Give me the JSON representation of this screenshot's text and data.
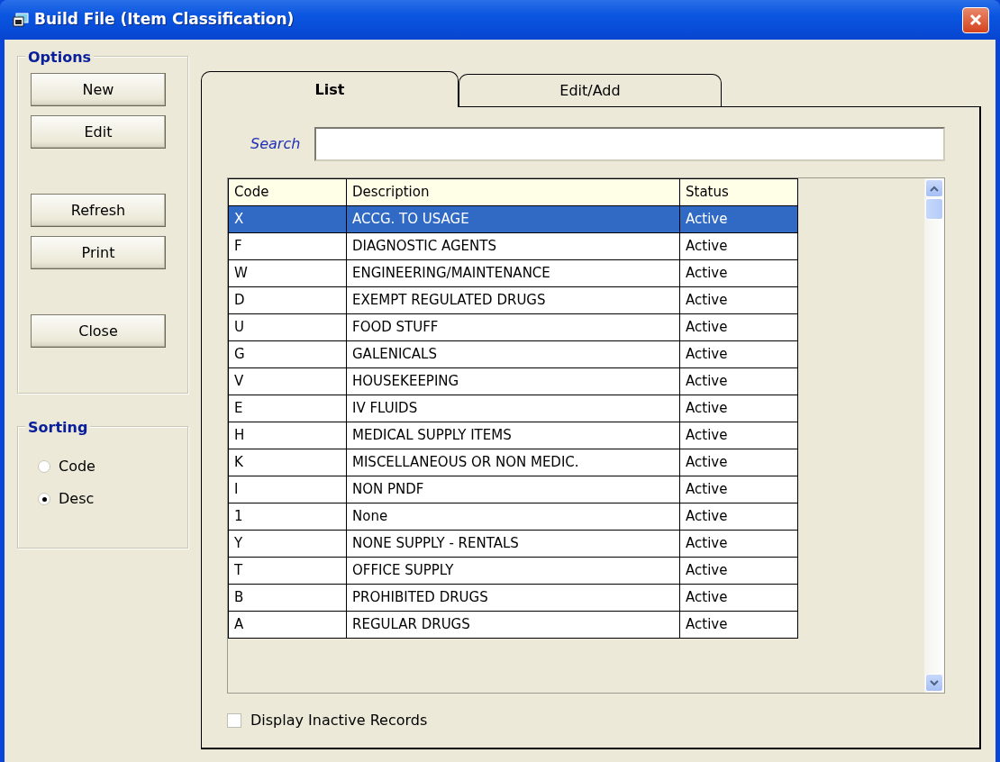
{
  "window": {
    "title": "Build File (Item Classification)"
  },
  "options": {
    "title": "Options",
    "buttons": [
      {
        "label": "New"
      },
      {
        "label": "Edit"
      },
      {
        "label": "Refresh"
      },
      {
        "label": "Print"
      },
      {
        "label": "Close"
      }
    ]
  },
  "sorting": {
    "title": "Sorting",
    "choices": [
      {
        "label": "Code",
        "selected": false
      },
      {
        "label": "Desc",
        "selected": true
      }
    ]
  },
  "tabs": [
    {
      "label": "List",
      "selected": true
    },
    {
      "label": "Edit/Add",
      "selected": false
    }
  ],
  "search": {
    "label": "Search"
  },
  "table": {
    "columns": [
      "Code",
      "Description",
      "Status"
    ],
    "rows": [
      {
        "code": "X",
        "description": "ACCG. TO USAGE",
        "status": "Active",
        "selected": true
      },
      {
        "code": "F",
        "description": "DIAGNOSTIC AGENTS",
        "status": "Active",
        "selected": false
      },
      {
        "code": "W",
        "description": "ENGINEERING/MAINTENANCE",
        "status": "Active",
        "selected": false
      },
      {
        "code": "D",
        "description": "EXEMPT REGULATED DRUGS",
        "status": "Active",
        "selected": false
      },
      {
        "code": "U",
        "description": "FOOD STUFF",
        "status": "Active",
        "selected": false
      },
      {
        "code": "G",
        "description": "GALENICALS",
        "status": "Active",
        "selected": false
      },
      {
        "code": "V",
        "description": "HOUSEKEEPING",
        "status": "Active",
        "selected": false
      },
      {
        "code": "E",
        "description": "IV FLUIDS",
        "status": "Active",
        "selected": false
      },
      {
        "code": "H",
        "description": "MEDICAL SUPPLY ITEMS",
        "status": "Active",
        "selected": false
      },
      {
        "code": "K",
        "description": "MISCELLANEOUS OR NON MEDIC.",
        "status": "Active",
        "selected": false
      },
      {
        "code": "I",
        "description": "NON PNDF",
        "status": "Active",
        "selected": false
      },
      {
        "code": "1",
        "description": "None",
        "status": "Active",
        "selected": false
      },
      {
        "code": "Y",
        "description": "NONE SUPPLY - RENTALS",
        "status": "Active",
        "selected": false
      },
      {
        "code": "T",
        "description": "OFFICE SUPPLY",
        "status": "Active",
        "selected": false
      },
      {
        "code": "B",
        "description": "PROHIBITED DRUGS",
        "status": "Active",
        "selected": false
      },
      {
        "code": "A",
        "description": "REGULAR DRUGS",
        "status": "Active",
        "selected": false
      }
    ]
  },
  "inactive_checkbox": {
    "label": "Display Inactive Records",
    "checked": false
  }
}
